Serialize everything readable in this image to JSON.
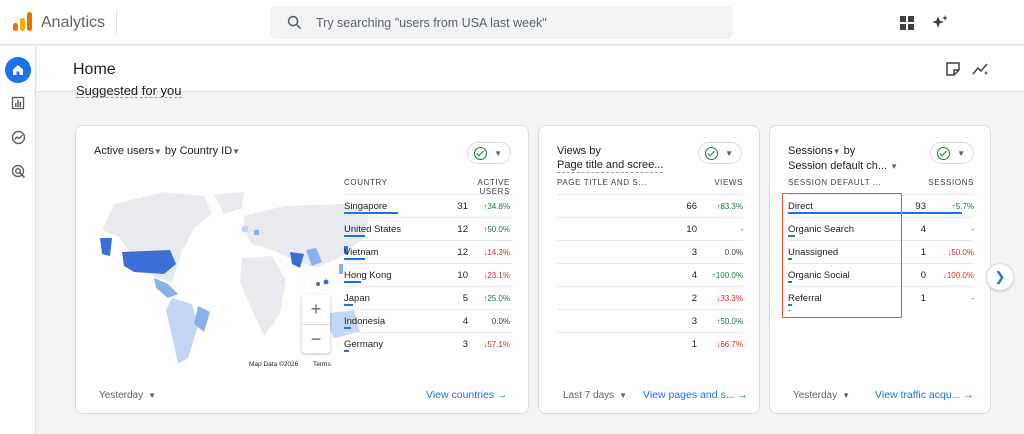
{
  "app": {
    "title": "Analytics"
  },
  "search": {
    "placeholder": "Try searching \"users from USA last week\""
  },
  "header": {
    "title": "Home"
  },
  "section": {
    "title": "Suggested for you"
  },
  "cards": [
    {
      "title_part1": "Active users",
      "title_part2": "by Country ID",
      "columns": [
        "COUNTRY",
        "ACTIVE USERS"
      ],
      "rows": [
        {
          "label": "Singapore",
          "value": "31",
          "change": "34.8%",
          "dir": "up",
          "bar": 1.0
        },
        {
          "label": "United States",
          "value": "12",
          "change": "50.0%",
          "dir": "up",
          "bar": 0.39
        },
        {
          "label": "Vietnam",
          "value": "12",
          "change": "14.3%",
          "dir": "down",
          "bar": 0.39
        },
        {
          "label": "Hong Kong",
          "value": "10",
          "change": "23.1%",
          "dir": "down",
          "bar": 0.32
        },
        {
          "label": "Japan",
          "value": "5",
          "change": "25.0%",
          "dir": "up",
          "bar": 0.16
        },
        {
          "label": "Indonesia",
          "value": "4",
          "change": "0.0%",
          "dir": "flat",
          "bar": 0.13
        },
        {
          "label": "Germany",
          "value": "3",
          "change": "57.1%",
          "dir": "down",
          "bar": 0.1
        }
      ],
      "map_attribution": "Map Data ©2026",
      "map_terms": "Terms",
      "zoom_in": "+",
      "zoom_out": "−",
      "period": "Yesterday",
      "link": "View countries"
    },
    {
      "title_part1": "Views by",
      "title_part2": "Page title and scree...",
      "columns": [
        "PAGE TITLE AND S...",
        "VIEWS"
      ],
      "rows": [
        {
          "label": "",
          "value": "66",
          "change": "83.3%",
          "dir": "up",
          "bar": 0
        },
        {
          "label": "",
          "value": "10",
          "change": "-",
          "dir": "flat",
          "bar": 0
        },
        {
          "label": "",
          "value": "3",
          "change": "0.0%",
          "dir": "flat",
          "bar": 0
        },
        {
          "label": "",
          "value": "4",
          "change": "100.0%",
          "dir": "up",
          "bar": 0
        },
        {
          "label": "",
          "value": "2",
          "change": "33.3%",
          "dir": "down",
          "bar": 0
        },
        {
          "label": "",
          "value": "3",
          "change": "50.0%",
          "dir": "up",
          "bar": 0
        },
        {
          "label": "",
          "value": "1",
          "change": "66.7%",
          "dir": "down",
          "bar": 0
        }
      ],
      "period": "Last 7 days",
      "link": "View pages and s..."
    },
    {
      "title_part1": "Sessions",
      "title_part1b": "by",
      "title_part2": "Session default ch...",
      "columns": [
        "SESSION DEFAULT ...",
        "SESSIONS"
      ],
      "rows": [
        {
          "label": "Direct",
          "value": "93",
          "change": "5.7%",
          "dir": "up",
          "bar": 1.0
        },
        {
          "label": "Organic Search",
          "value": "4",
          "change": "-",
          "dir": "flat",
          "bar": 0.04
        },
        {
          "label": "Unassigned",
          "value": "1",
          "change": "50.0%",
          "dir": "down",
          "bar": 0.01
        },
        {
          "label": "Organic Social",
          "value": "0",
          "change": "100.0%",
          "dir": "down",
          "bar": 0.0
        },
        {
          "label": "Referral",
          "value": "1",
          "change": "-",
          "dir": "flat",
          "bar": 0.01
        }
      ],
      "extra_label": "-",
      "period": "Yesterday",
      "link": "View traffic acqu..."
    }
  ],
  "colors": {
    "accent": "#1a73e8",
    "up": "#188038",
    "down": "#d93025",
    "highlight": "#e8573f"
  }
}
